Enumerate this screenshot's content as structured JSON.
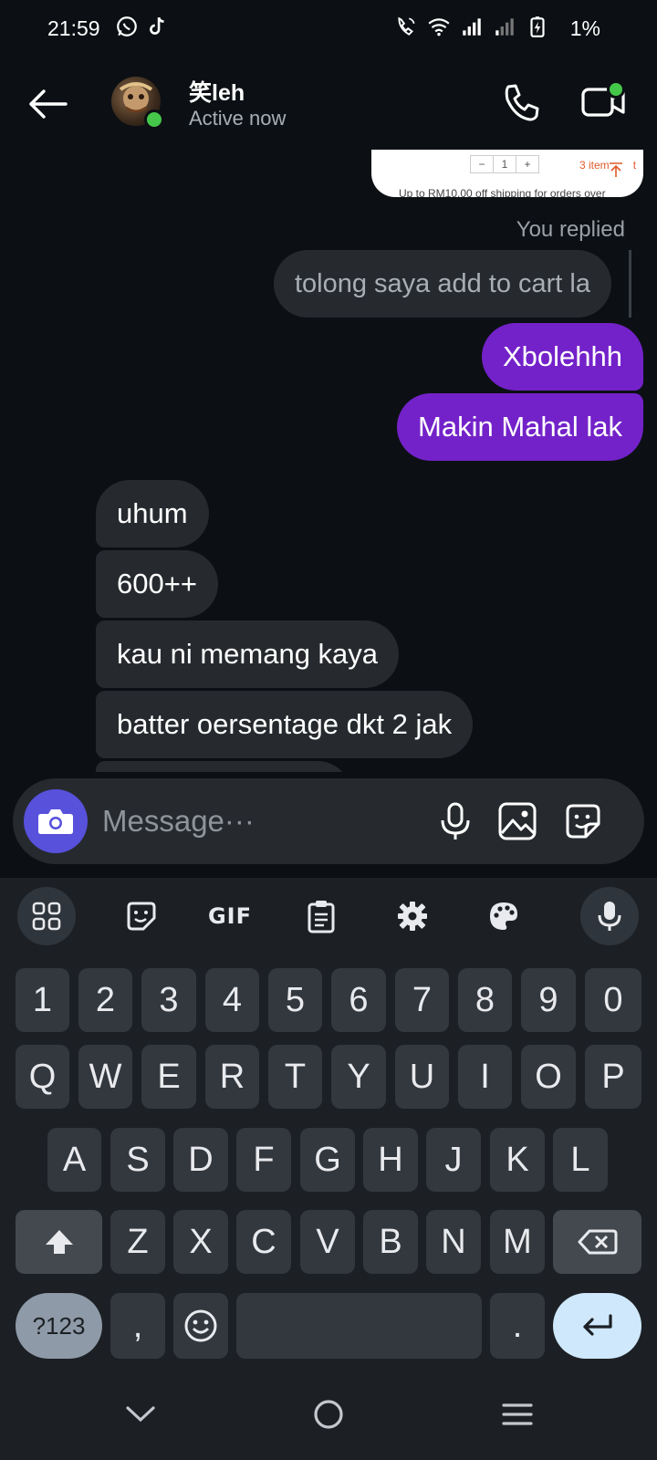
{
  "status_bar": {
    "time": "21:59",
    "battery": "1%",
    "icons": [
      "whatsapp-icon",
      "tiktok-icon",
      "wifi-call-icon",
      "wifi-icon",
      "signal-icon",
      "signal-icon-2",
      "battery-charging-icon"
    ]
  },
  "header": {
    "contact_name": "笑leh",
    "status": "Active now",
    "online_color": "#45c84a"
  },
  "preview": {
    "qty_minus": "−",
    "qty_value": "1",
    "qty_plus": "+",
    "items": "3 item",
    "items_suffix": "t",
    "shipping": "Up to RM10.00 off shipping for orders over"
  },
  "chat": {
    "replied_label": "You replied",
    "quoted_message": "tolong saya add to cart la",
    "my_messages": [
      "Xbolehhh",
      "Makin Mahal lak"
    ],
    "their_messages": [
      "uhum",
      "600++",
      "kau ni memang kaya",
      "batter oersentage dkt 2 jak"
    ],
    "my_bubble_color": "#7322c9",
    "their_bubble_color": "#262a2f"
  },
  "composer": {
    "placeholder": "Message···",
    "accent": "#5851db"
  },
  "keyboard": {
    "toolbar": {
      "gif_label": "GIF"
    },
    "row_numbers": [
      "1",
      "2",
      "3",
      "4",
      "5",
      "6",
      "7",
      "8",
      "9",
      "0"
    ],
    "row_top": [
      "Q",
      "W",
      "E",
      "R",
      "T",
      "Y",
      "U",
      "I",
      "O",
      "P"
    ],
    "row_middle": [
      "A",
      "S",
      "D",
      "F",
      "G",
      "H",
      "J",
      "K",
      "L"
    ],
    "row_bottom": [
      "Z",
      "X",
      "C",
      "V",
      "B",
      "N",
      "M"
    ],
    "sym_label": "?123",
    "comma": ",",
    "period": "."
  }
}
